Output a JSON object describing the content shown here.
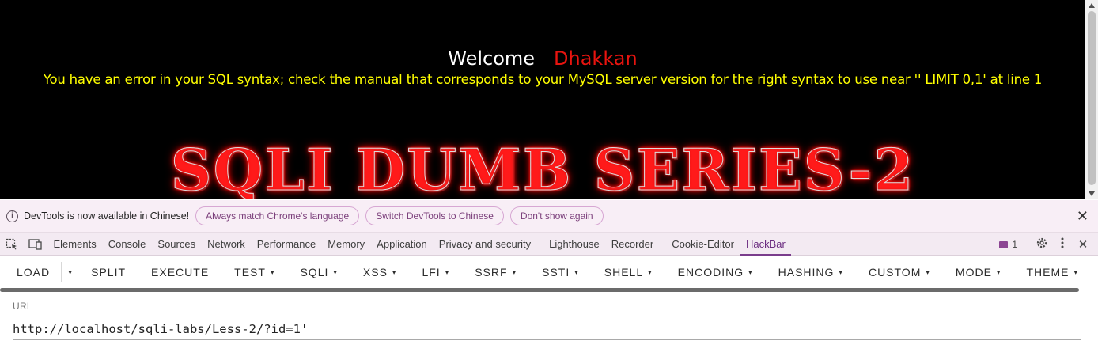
{
  "page": {
    "welcome": "Welcome",
    "username": "Dhakkan",
    "error": "You have an error in your SQL syntax; check the manual that corresponds to your MySQL server version for the right syntax to use near '' LIMIT 0,1' at line 1",
    "banner": "SQLI DUMB SERIES-2"
  },
  "infobar": {
    "message": "DevTools is now available in Chinese!",
    "buttons": [
      "Always match Chrome's language",
      "Switch DevTools to Chinese",
      "Don't show again"
    ],
    "close": "✕"
  },
  "devtools": {
    "tabs": [
      "Elements",
      "Console",
      "Sources",
      "Network",
      "Performance",
      "Memory",
      "Application",
      "Privacy and security",
      "Lighthouse",
      "Recorder",
      "Cookie-Editor",
      "HackBar"
    ],
    "active_tab": "HackBar",
    "issues_count": "1",
    "settings_icon": "gear-icon",
    "more_icon": "more-vert-icon",
    "close": "✕"
  },
  "hackbar": {
    "load": "LOAD",
    "split": "SPLIT",
    "execute": "EXECUTE",
    "menus": [
      "TEST",
      "SQLI",
      "XSS",
      "LFI",
      "SSRF",
      "SSTI",
      "SHELL",
      "ENCODING",
      "HASHING",
      "CUSTOM",
      "MODE",
      "THEME"
    ],
    "caret": "▾"
  },
  "url": {
    "label": "URL",
    "value": "http://localhost/sqli-labs/Less-2/?id=1'"
  },
  "colors": {
    "welcome_name": "#e8140f",
    "error_text": "#ffff00",
    "accent": "#7a3c8c"
  }
}
